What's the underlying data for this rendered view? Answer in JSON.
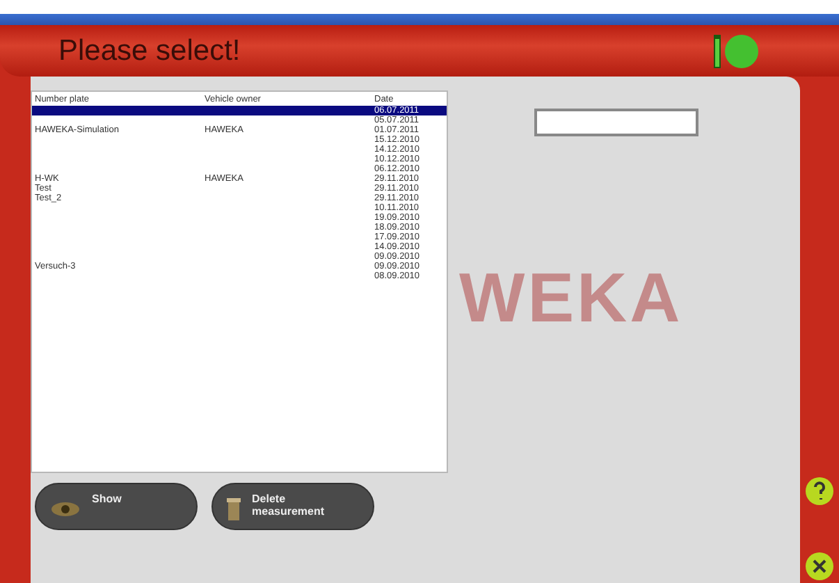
{
  "header": {
    "title": "Please select!"
  },
  "table": {
    "columns": [
      "Number plate",
      "Vehicle owner",
      "Date"
    ],
    "rows": [
      {
        "plate": "",
        "owner": "",
        "date": "06.07.2011",
        "selected": true
      },
      {
        "plate": "",
        "owner": "",
        "date": "05.07.2011",
        "selected": false
      },
      {
        "plate": "HAWEKA-Simulation",
        "owner": "HAWEKA",
        "date": "01.07.2011",
        "selected": false
      },
      {
        "plate": "",
        "owner": "",
        "date": "15.12.2010",
        "selected": false
      },
      {
        "plate": "",
        "owner": "",
        "date": "14.12.2010",
        "selected": false
      },
      {
        "plate": "",
        "owner": "",
        "date": "10.12.2010",
        "selected": false
      },
      {
        "plate": "",
        "owner": "",
        "date": "06.12.2010",
        "selected": false
      },
      {
        "plate": "H-WK",
        "owner": "HAWEKA",
        "date": "29.11.2010",
        "selected": false
      },
      {
        "plate": "Test",
        "owner": "",
        "date": "29.11.2010",
        "selected": false
      },
      {
        "plate": "Test_2",
        "owner": "",
        "date": "29.11.2010",
        "selected": false
      },
      {
        "plate": "",
        "owner": "",
        "date": "10.11.2010",
        "selected": false
      },
      {
        "plate": "",
        "owner": "",
        "date": "19.09.2010",
        "selected": false
      },
      {
        "plate": "",
        "owner": "",
        "date": "18.09.2010",
        "selected": false
      },
      {
        "plate": "",
        "owner": "",
        "date": "17.09.2010",
        "selected": false
      },
      {
        "plate": "",
        "owner": "",
        "date": "14.09.2010",
        "selected": false
      },
      {
        "plate": "",
        "owner": "",
        "date": "09.09.2010",
        "selected": false
      },
      {
        "plate": "Versuch-3",
        "owner": "",
        "date": "09.09.2010",
        "selected": false
      },
      {
        "plate": "",
        "owner": "",
        "date": "08.09.2010",
        "selected": false
      }
    ]
  },
  "background_logo": "WEKA",
  "buttons": [
    {
      "label": "Show",
      "kind": "show"
    },
    {
      "label": "Delete measurement",
      "kind": "delete"
    }
  ]
}
